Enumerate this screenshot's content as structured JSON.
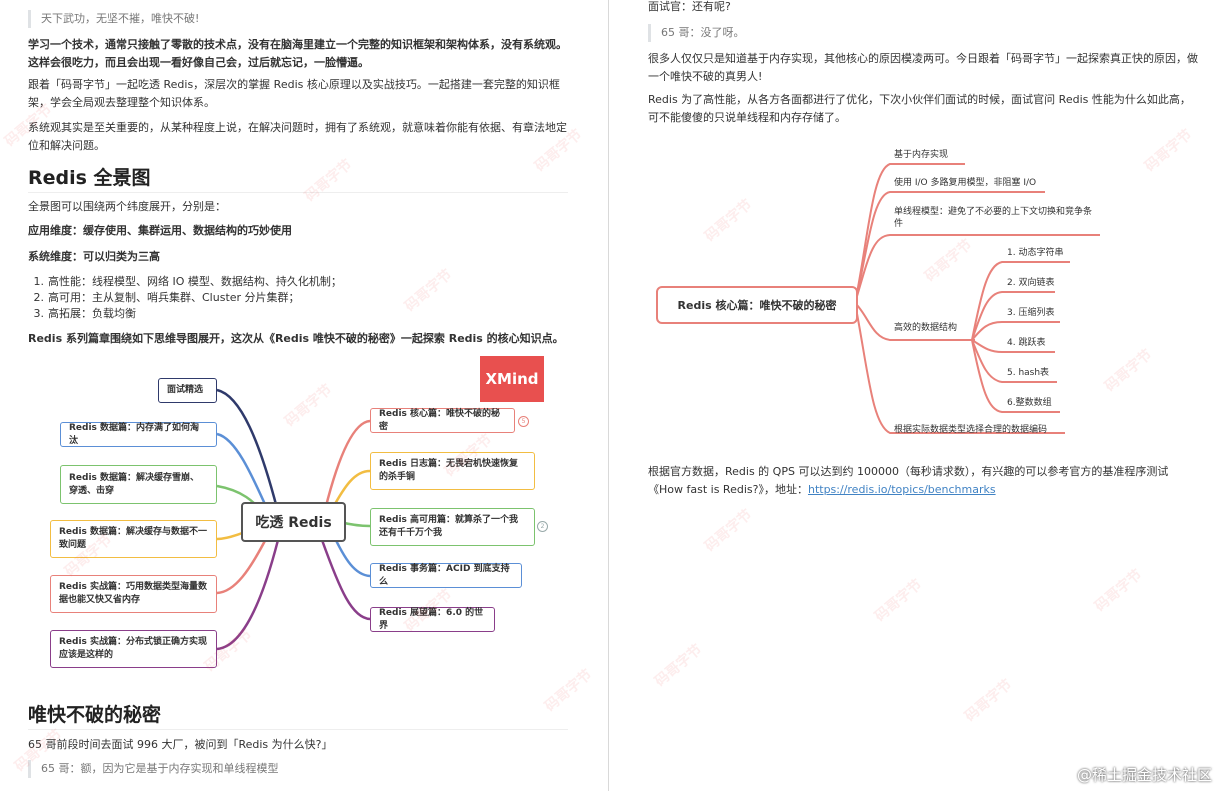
{
  "left": {
    "quote_top": "天下武功，无坚不摧，唯快不破!",
    "para1": "学习一个技术，通常只接触了零散的技术点，没有在脑海里建立一个完整的知识框架和架构体系，没有系统观。这样会很吃力，而且会出现一看好像自己会，过后就忘记，一脸懵逼。",
    "para2": "跟着「码哥字节」一起吃透 Redis，深层次的掌握 Redis 核心原理以及实战技巧。一起搭建一套完整的知识框架，学会全局观去整理整个知识体系。",
    "para3": "系统观其实是至关重要的，从某种程度上说，在解决问题时，拥有了系统观，就意味着你能有依据、有章法地定位和解决问题。",
    "heading1": "Redis 全景图",
    "para4": "全景图可以围绕两个纬度展开，分别是：",
    "para5": "应用维度：缓存使用、集群运用、数据结构的巧妙使用",
    "para6": "系统维度：可以归类为三高",
    "list": [
      {
        "num": "1.",
        "text": "高性能：线程模型、网络 IO 模型、数据结构、持久化机制；"
      },
      {
        "num": "2.",
        "text": "高可用：主从复制、哨兵集群、Cluster 分片集群；"
      },
      {
        "num": "3.",
        "text": "高拓展：负载均衡"
      }
    ],
    "para7": "Redis 系列篇章围绕如下思维导图展开，这次从《Redis 唯快不破的秘密》一起探索 Redis 的核心知识点。",
    "mindmap": {
      "center": "吃透 Redis",
      "xmind": "XMind",
      "left_nodes": [
        "面试精选",
        "Redis 数据篇：内存满了如何淘汰",
        "Redis 数据篇：解决缓存雪崩、穿透、击穿",
        "Redis 数据篇：解决缓存与数据不一致问题",
        "Redis 实战篇：巧用数据类型海量数据也能又快又省内存",
        "Redis 实战篇：分布式锁正确方实现应该是这样的"
      ],
      "right_nodes": [
        "Redis 核心篇：唯快不破的秘密",
        "Redis 日志篇：无畏宕机快速恢复的杀手锏",
        "Redis 高可用篇：就算杀了一个我还有千千万个我",
        "Redis 事务篇：ACID 到底支持么",
        "Redis 展望篇：6.0 的世界"
      ],
      "badge1": "5",
      "badge2": "2"
    },
    "heading2": "唯快不破的秘密",
    "para8": "65 哥前段时间去面试 996 大厂，被问到「Redis 为什么快?」",
    "quote_bottom": "65 哥：额，因为它是基于内存实现和单线程模型"
  },
  "right": {
    "para_top": "面试官：还有呢?",
    "quote1": "65 哥：没了呀。",
    "para1": "很多人仅仅只是知道基于内存实现，其他核心的原因模凌两可。今日跟着「码哥字节」一起探索真正快的原因，做一个唯快不破的真男人!",
    "para2": "Redis 为了高性能，从各方各面都进行了优化，下次小伙伴们面试的时候，面试官问 Redis 性能为什么如此高，可不能傻傻的只说单线程和内存存储了。",
    "mindmap": {
      "root": "Redis 核心篇：唯快不破的秘密",
      "branches": [
        "基于内存实现",
        "使用 I/O 多路复用模型，非阻塞 I/O",
        "单线程模型：避免了不必要的上下文切换和竞争条件",
        "高效的数据结构",
        "根据实际数据类型选择合理的数据编码"
      ],
      "data_structures": [
        "1. 动态字符串",
        "2. 双向链表",
        "3. 压缩列表",
        "4. 跳跃表",
        "5. hash表",
        "6.整数数组"
      ]
    },
    "para3_text": "根据官方数据，Redis 的 QPS 可以达到约 100000（每秒请求数），有兴趣的可以参考官方的基准程序测试《How fast is Redis?》，地址：",
    "para3_link": "https://redis.io/topics/benchmarks"
  },
  "watermark": "码哥字节",
  "site_mark": "@稀土掘金技术社区",
  "colors": {
    "red": "#e8817a",
    "blue": "#5b8fd6",
    "green": "#7cc36e",
    "yellow": "#f2bd42",
    "purple": "#8a3e8a",
    "navy": "#2f3a6b",
    "link": "#4183c4"
  }
}
